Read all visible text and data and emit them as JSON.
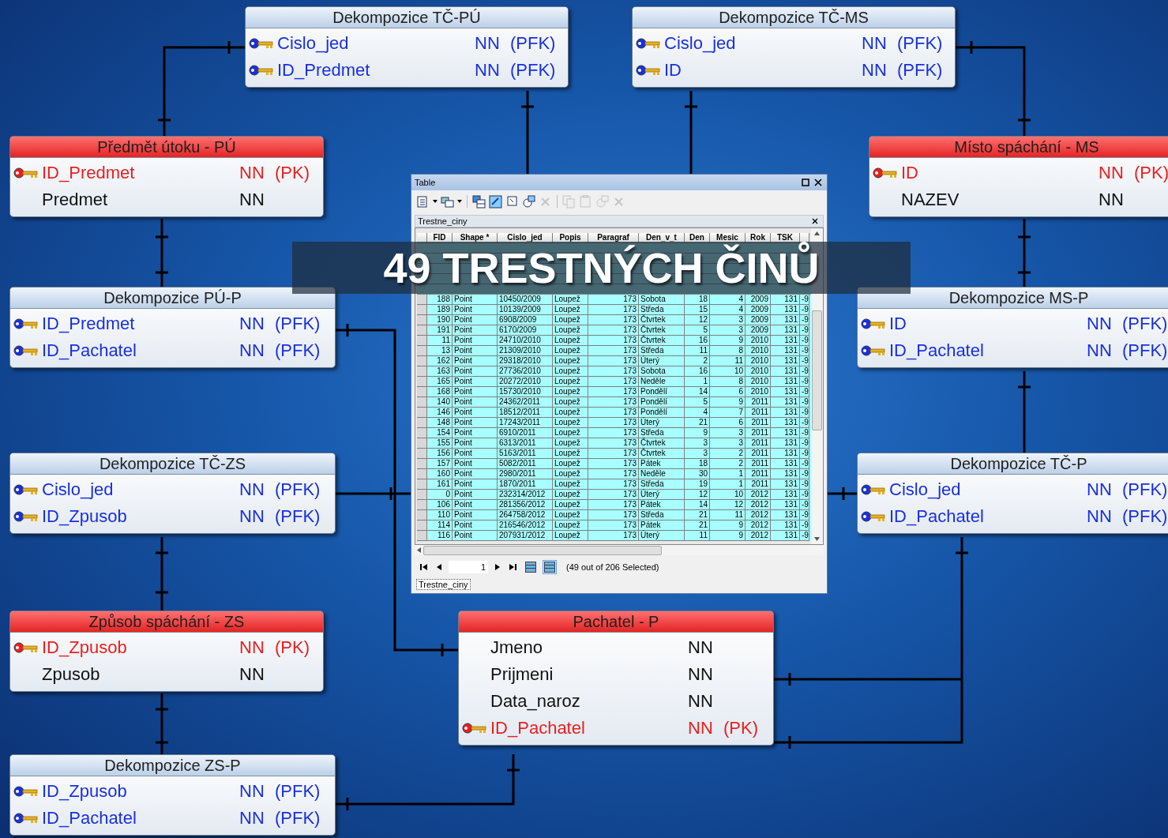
{
  "entities": [
    {
      "kind": "relation",
      "title": "Dekompozice TČ-PÚ",
      "fields": [
        {
          "kind": "fk",
          "name": "Cislo_jed",
          "null": "NN",
          "key": "(PFK)"
        },
        {
          "kind": "fk",
          "name": "ID_Predmet",
          "null": "NN",
          "key": "(PFK)"
        }
      ]
    },
    {
      "kind": "relation",
      "title": "Dekompozice TČ-MS",
      "fields": [
        {
          "kind": "fk",
          "name": "Cislo_jed",
          "null": "NN",
          "key": "(PFK)"
        },
        {
          "kind": "fk",
          "name": "ID",
          "null": "NN",
          "key": "(PFK)"
        }
      ]
    },
    {
      "kind": "entity",
      "title": "Předmět útoku - PÚ",
      "fields": [
        {
          "kind": "pk",
          "name": "ID_Predmet",
          "null": "NN",
          "key": "(PK)"
        },
        {
          "kind": "attr",
          "name": "Predmet",
          "null": "NN"
        }
      ]
    },
    {
      "kind": "entity",
      "title": "Místo spáchání - MS",
      "fields": [
        {
          "kind": "pk",
          "name": "ID",
          "null": "NN",
          "key": "(PK)"
        },
        {
          "kind": "attr",
          "name": "NAZEV",
          "null": "NN"
        }
      ]
    },
    {
      "kind": "relation",
      "title": "Dekompozice PÚ-P",
      "fields": [
        {
          "kind": "fk",
          "name": "ID_Predmet",
          "null": "NN",
          "key": "(PFK)"
        },
        {
          "kind": "fk",
          "name": "ID_Pachatel",
          "null": "NN",
          "key": "(PFK)"
        }
      ]
    },
    {
      "kind": "relation",
      "title": "Dekompozice MS-P",
      "fields": [
        {
          "kind": "fk",
          "name": "ID",
          "null": "NN",
          "key": "(PFK)"
        },
        {
          "kind": "fk",
          "name": "ID_Pachatel",
          "null": "NN",
          "key": "(PFK)"
        }
      ]
    },
    {
      "kind": "relation",
      "title": "Dekompozice TČ-ZS",
      "fields": [
        {
          "kind": "fk",
          "name": "Cislo_jed",
          "null": "NN",
          "key": "(PFK)"
        },
        {
          "kind": "fk",
          "name": "ID_Zpusob",
          "null": "NN",
          "key": "(PFK)"
        }
      ]
    },
    {
      "kind": "relation",
      "title": "Dekompozice TČ-P",
      "fields": [
        {
          "kind": "fk",
          "name": "Cislo_jed",
          "null": "NN",
          "key": "(PFK)"
        },
        {
          "kind": "fk",
          "name": "ID_Pachatel",
          "null": "NN",
          "key": "(PFK)"
        }
      ]
    },
    {
      "kind": "entity",
      "title": "Způsob spáchání - ZS",
      "fields": [
        {
          "kind": "pk",
          "name": "ID_Zpusob",
          "null": "NN",
          "key": "(PK)"
        },
        {
          "kind": "attr",
          "name": "Zpusob",
          "null": "NN"
        }
      ]
    },
    {
      "kind": "entity",
      "title": "Pachatel - P",
      "fields": [
        {
          "kind": "attr",
          "name": "Jmeno",
          "null": "NN"
        },
        {
          "kind": "attr",
          "name": "Prijmeni",
          "null": "NN"
        },
        {
          "kind": "attr",
          "name": "Data_naroz",
          "null": "NN"
        },
        {
          "kind": "pk",
          "name": "ID_Pachatel",
          "null": "NN",
          "key": "(PK)"
        }
      ]
    },
    {
      "kind": "relation",
      "title": "Dekompozice ZS-P",
      "fields": [
        {
          "kind": "fk",
          "name": "ID_Zpusob",
          "null": "NN",
          "key": "(PFK)"
        },
        {
          "kind": "fk",
          "name": "ID_Pachatel",
          "null": "NN",
          "key": "(PFK)"
        }
      ]
    }
  ],
  "table_window": {
    "title": "Table",
    "layer": "Trestne_ciny",
    "toolbar": [
      {
        "disabled": false
      },
      {
        "disabled": false
      },
      {
        "disabled": false
      },
      {
        "disabled": false
      },
      {
        "disabled": false
      },
      {
        "disabled": false
      },
      {
        "disabled": true
      },
      {
        "disabled": true
      },
      {
        "disabled": true
      },
      {
        "disabled": true
      },
      {
        "disabled": true
      }
    ],
    "columns": [
      {
        "label": "FID",
        "kind": "number"
      },
      {
        "label": "Shape *",
        "kind": "text"
      },
      {
        "label": "Cislo_jed",
        "kind": "text"
      },
      {
        "label": "Popis",
        "kind": "text"
      },
      {
        "label": "Paragraf",
        "kind": "number"
      },
      {
        "label": "Den_v_t",
        "kind": "text"
      },
      {
        "label": "Den",
        "kind": "number"
      },
      {
        "label": "Mesic",
        "kind": "number"
      },
      {
        "label": "Rok",
        "kind": "number"
      },
      {
        "label": "TSK",
        "kind": "number"
      },
      {
        "kind": "number"
      }
    ],
    "rows": [
      {
        "selected": true,
        "cells": [
          "188",
          "Point",
          "10450/2009",
          "Loupež",
          "173",
          "Sobota",
          "18",
          "4",
          "2009",
          "131",
          "-9"
        ]
      },
      {
        "selected": true,
        "cells": [
          "189",
          "Point",
          "10139/2009",
          "Loupež",
          "173",
          "Středa",
          "15",
          "4",
          "2009",
          "131",
          "-9"
        ]
      },
      {
        "selected": true,
        "cells": [
          "190",
          "Point",
          "6908/2009",
          "Loupež",
          "173",
          "Čtvrtek",
          "12",
          "3",
          "2009",
          "131",
          "-9"
        ]
      },
      {
        "selected": true,
        "cells": [
          "191",
          "Point",
          "6170/2009",
          "Loupež",
          "173",
          "Čtvrtek",
          "5",
          "3",
          "2009",
          "131",
          "-9"
        ]
      },
      {
        "selected": true,
        "cells": [
          "11",
          "Point",
          "24710/2010",
          "Loupež",
          "173",
          "Čtvrtek",
          "16",
          "9",
          "2010",
          "131",
          "-9"
        ]
      },
      {
        "selected": true,
        "cells": [
          "13",
          "Point",
          "21309/2010",
          "Loupež",
          "173",
          "Středa",
          "11",
          "8",
          "2010",
          "131",
          "-9"
        ]
      },
      {
        "selected": true,
        "cells": [
          "162",
          "Point",
          "29318/2010",
          "Loupež",
          "173",
          "Úterý",
          "2",
          "11",
          "2010",
          "131",
          "-9"
        ]
      },
      {
        "selected": true,
        "cells": [
          "163",
          "Point",
          "27736/2010",
          "Loupež",
          "173",
          "Sobota",
          "16",
          "10",
          "2010",
          "131",
          "-9"
        ]
      },
      {
        "selected": true,
        "cells": [
          "165",
          "Point",
          "20272/2010",
          "Loupež",
          "173",
          "Neděle",
          "1",
          "8",
          "2010",
          "131",
          "-9"
        ]
      },
      {
        "selected": true,
        "cells": [
          "168",
          "Point",
          "15730/2010",
          "Loupež",
          "173",
          "Pondělí",
          "14",
          "6",
          "2010",
          "131",
          "-9"
        ]
      },
      {
        "selected": true,
        "cells": [
          "140",
          "Point",
          "24362/2011",
          "Loupež",
          "173",
          "Pondělí",
          "5",
          "9",
          "2011",
          "131",
          "-9"
        ]
      },
      {
        "selected": true,
        "cells": [
          "146",
          "Point",
          "18512/2011",
          "Loupež",
          "173",
          "Pondělí",
          "4",
          "7",
          "2011",
          "131",
          "-9"
        ]
      },
      {
        "selected": true,
        "cells": [
          "148",
          "Point",
          "17243/2011",
          "Loupež",
          "173",
          "Úterý",
          "21",
          "6",
          "2011",
          "131",
          "-9"
        ]
      },
      {
        "selected": true,
        "cells": [
          "154",
          "Point",
          "6910/2011",
          "Loupež",
          "173",
          "Středa",
          "9",
          "3",
          "2011",
          "131",
          "-9"
        ]
      },
      {
        "selected": true,
        "cells": [
          "155",
          "Point",
          "6313/2011",
          "Loupež",
          "173",
          "Čtvrtek",
          "3",
          "3",
          "2011",
          "131",
          "-9"
        ]
      },
      {
        "selected": true,
        "cells": [
          "156",
          "Point",
          "5163/2011",
          "Loupež",
          "173",
          "Čtvrtek",
          "3",
          "2",
          "2011",
          "131",
          "-9"
        ]
      },
      {
        "selected": true,
        "cells": [
          "157",
          "Point",
          "5082/2011",
          "Loupež",
          "173",
          "Pátek",
          "18",
          "2",
          "2011",
          "131",
          "-9"
        ]
      },
      {
        "selected": true,
        "cells": [
          "160",
          "Point",
          "2980/2011",
          "Loupež",
          "173",
          "Neděle",
          "30",
          "1",
          "2011",
          "131",
          "-9"
        ]
      },
      {
        "selected": true,
        "cells": [
          "161",
          "Point",
          "1870/2011",
          "Loupež",
          "173",
          "Středa",
          "19",
          "1",
          "2011",
          "131",
          "-9"
        ]
      },
      {
        "selected": true,
        "cells": [
          "0",
          "Point",
          "232314/2012",
          "Loupež",
          "173",
          "Úterý",
          "12",
          "10",
          "2012",
          "131",
          "-9"
        ]
      },
      {
        "selected": true,
        "cells": [
          "106",
          "Point",
          "281356/2012",
          "Loupež",
          "173",
          "Pátek",
          "14",
          "12",
          "2012",
          "131",
          "-9"
        ]
      },
      {
        "selected": true,
        "cells": [
          "110",
          "Point",
          "264758/2012",
          "Loupež",
          "173",
          "Středa",
          "21",
          "11",
          "2012",
          "131",
          "-9"
        ]
      },
      {
        "selected": true,
        "cells": [
          "114",
          "Point",
          "216546/2012",
          "Loupež",
          "173",
          "Pátek",
          "21",
          "9",
          "2012",
          "131",
          "-9"
        ]
      },
      {
        "selected": true,
        "cells": [
          "116",
          "Point",
          "207931/2012",
          "Loupež",
          "173",
          "Úterý",
          "11",
          "9",
          "2012",
          "131",
          "-9"
        ]
      }
    ],
    "page": "1",
    "views": [
      {
        "selected": false
      },
      {
        "selected": true
      }
    ],
    "status": "(49 out of 206 Selected)",
    "tab": "Trestne_ciny"
  },
  "banner": {
    "text": "49 TRESTNÝCH ČINŮ"
  }
}
